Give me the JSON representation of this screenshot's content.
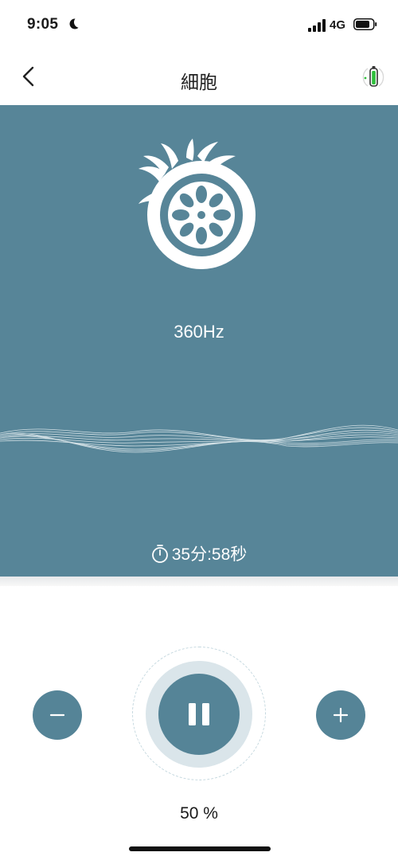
{
  "status_bar": {
    "time": "9:05",
    "network": "4G",
    "moon_icon": "moon-icon",
    "signal_icon": "signal-bars-icon",
    "battery_icon": "battery-icon"
  },
  "nav": {
    "title": "細胞",
    "back_icon": "chevron-left-icon",
    "device_icon": "device-battery-icon"
  },
  "hero": {
    "background_color": "#578598",
    "icon": "cell-icon",
    "frequency": "360Hz",
    "timer_icon": "stopwatch-icon",
    "timer": "35分:58秒"
  },
  "controls": {
    "minus_icon": "minus-icon",
    "plus_icon": "plus-icon",
    "pause_icon": "pause-icon",
    "accent_color": "#558497",
    "intensity_percent": 50,
    "intensity_label": "50 %"
  }
}
